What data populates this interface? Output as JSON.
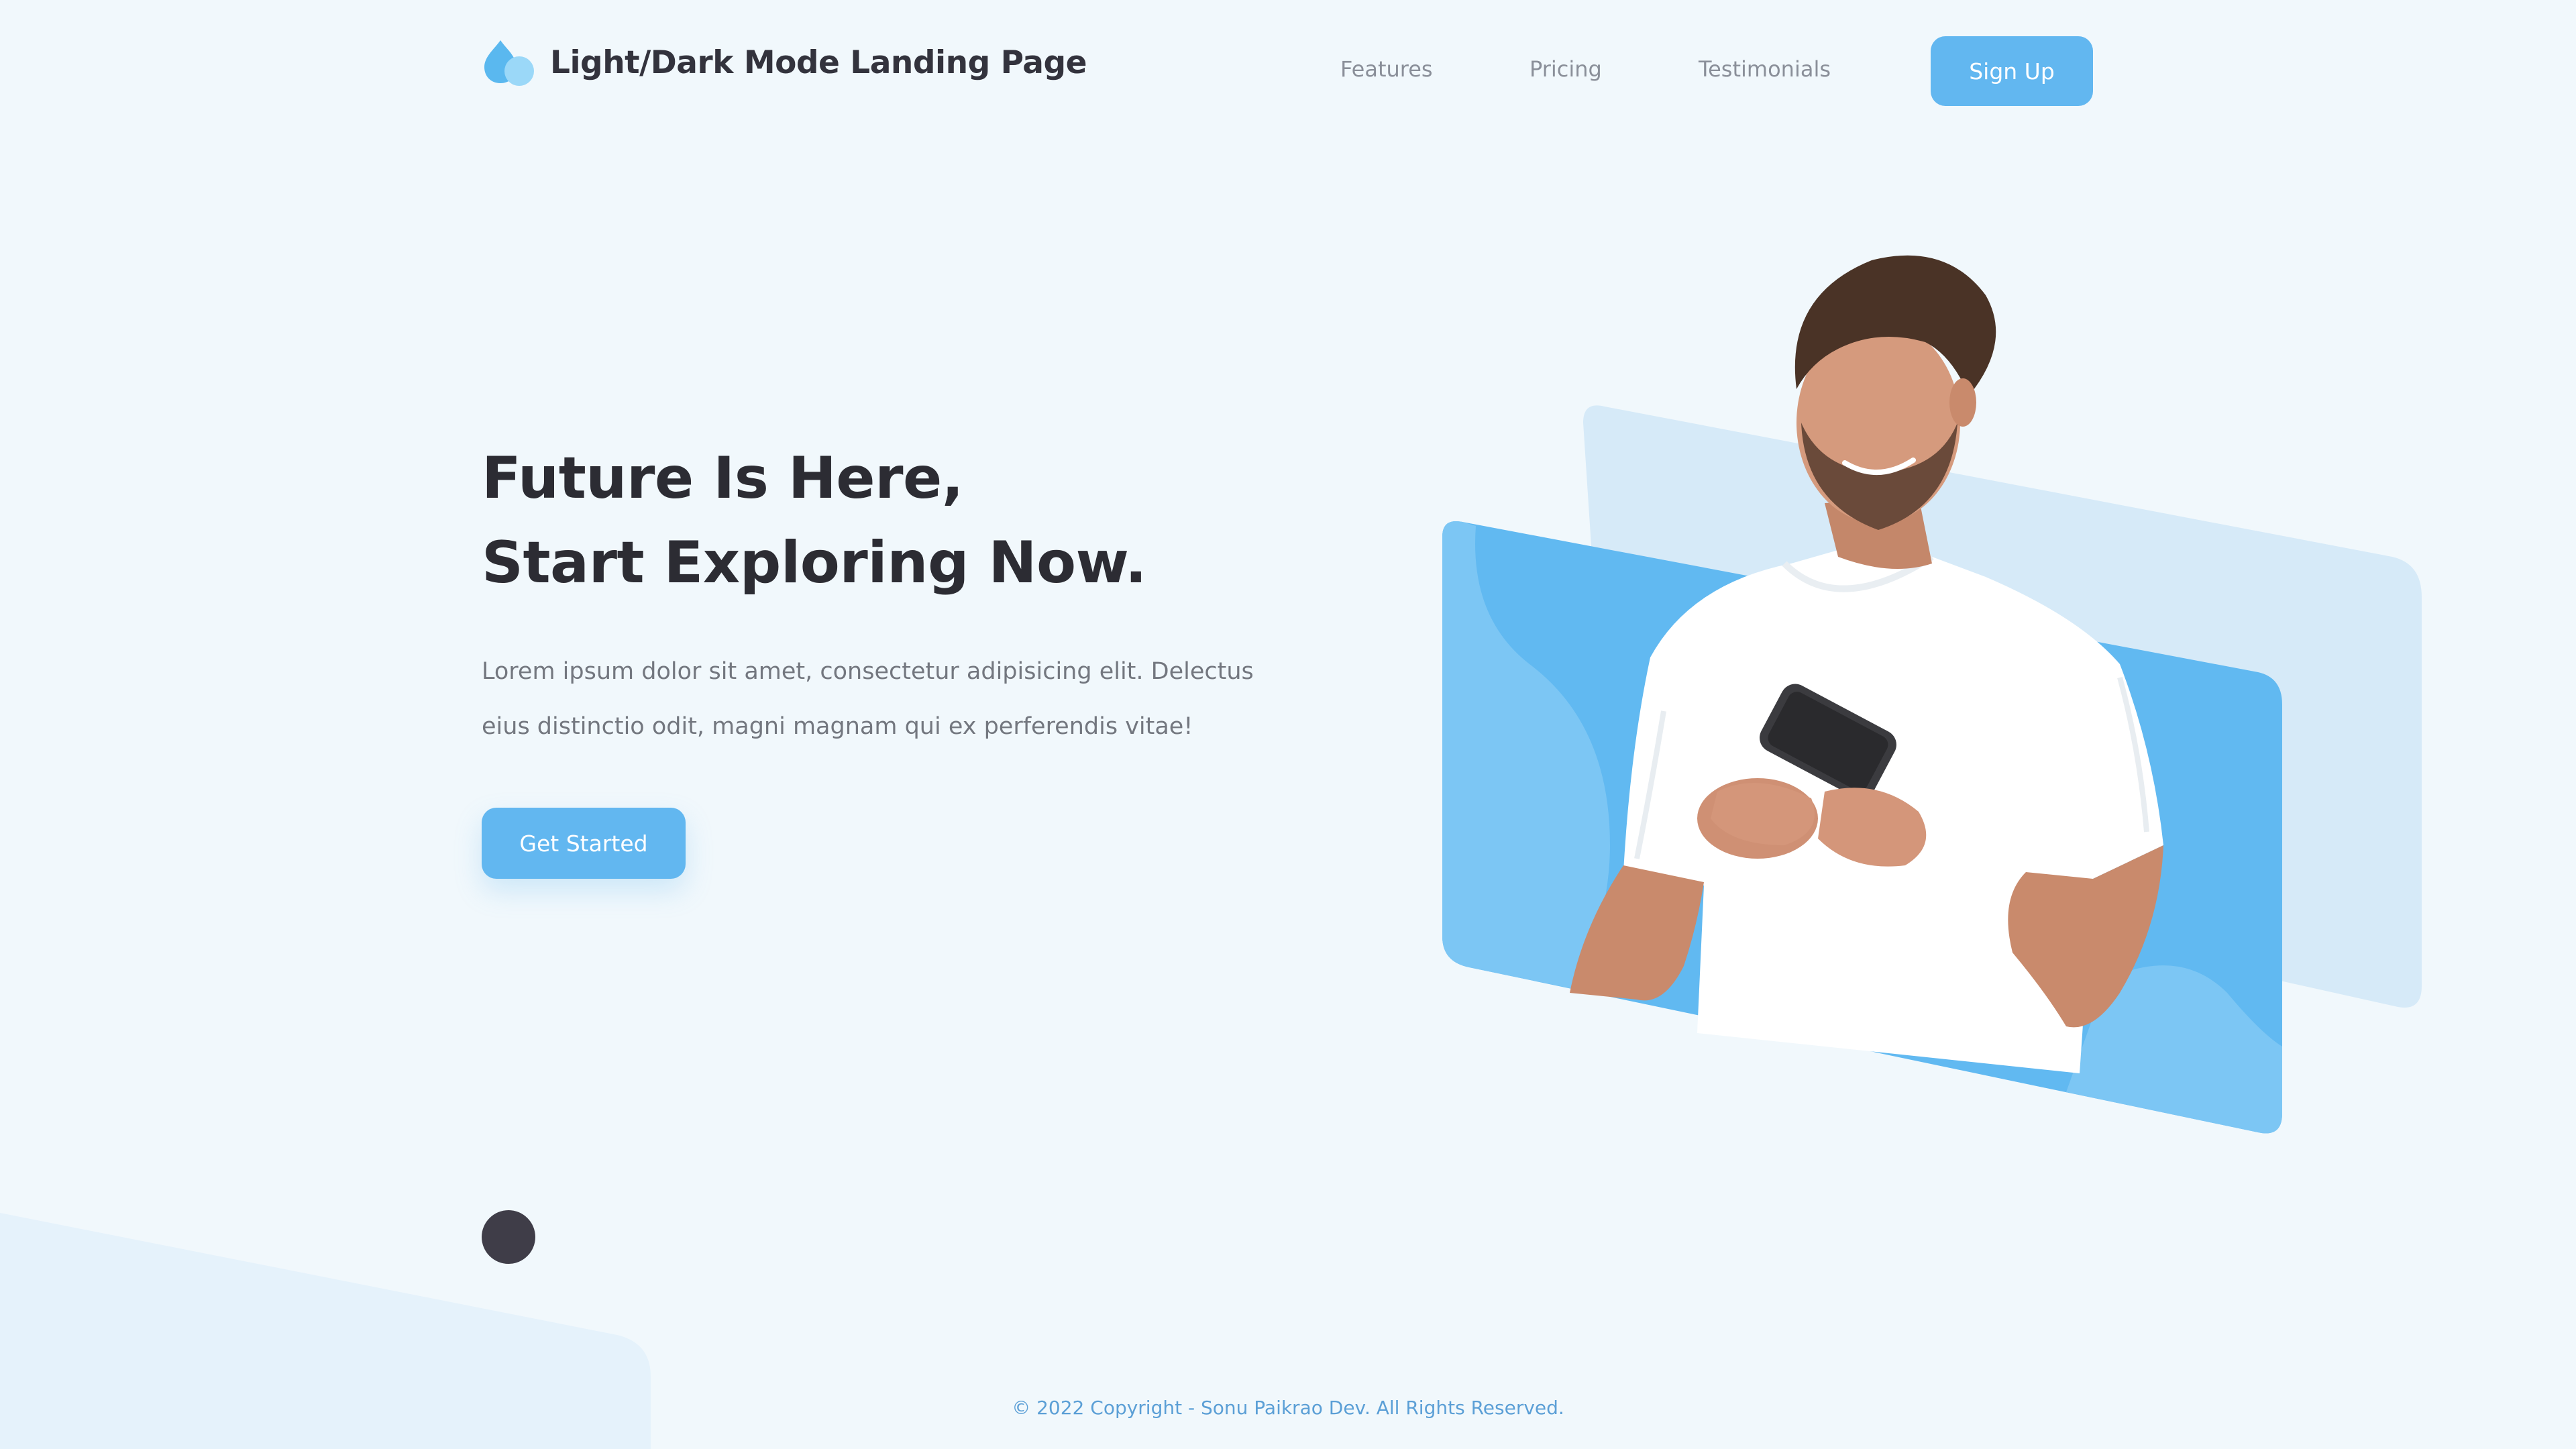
{
  "header": {
    "brand": "Light/Dark Mode Landing Page",
    "logo_icon": "water-drop-icon",
    "nav": {
      "features": "Features",
      "pricing": "Pricing",
      "testimonials": "Testimonials"
    },
    "signup_label": "Sign Up"
  },
  "hero": {
    "title_line1": "Future Is Here,",
    "title_line2": "Start Exploring Now.",
    "description": "Lorem ipsum dolor sit amet, consectetur adipisicing elit. Delectus eius distinctio odit, magni magnam qui ex perferendis vitae!",
    "cta_label": "Get Started"
  },
  "theme_toggle": {
    "icon": "theme-toggle-icon"
  },
  "footer": {
    "copyright": "© 2022 Copyright - Sonu Paikrao Dev. All Rights Reserved."
  },
  "colors": {
    "background": "#f1f8fc",
    "accent": "#62b7f0",
    "accent_light": "#d7ebf9",
    "text_dark": "#2c2c33",
    "toggle": "#3f3d48"
  }
}
